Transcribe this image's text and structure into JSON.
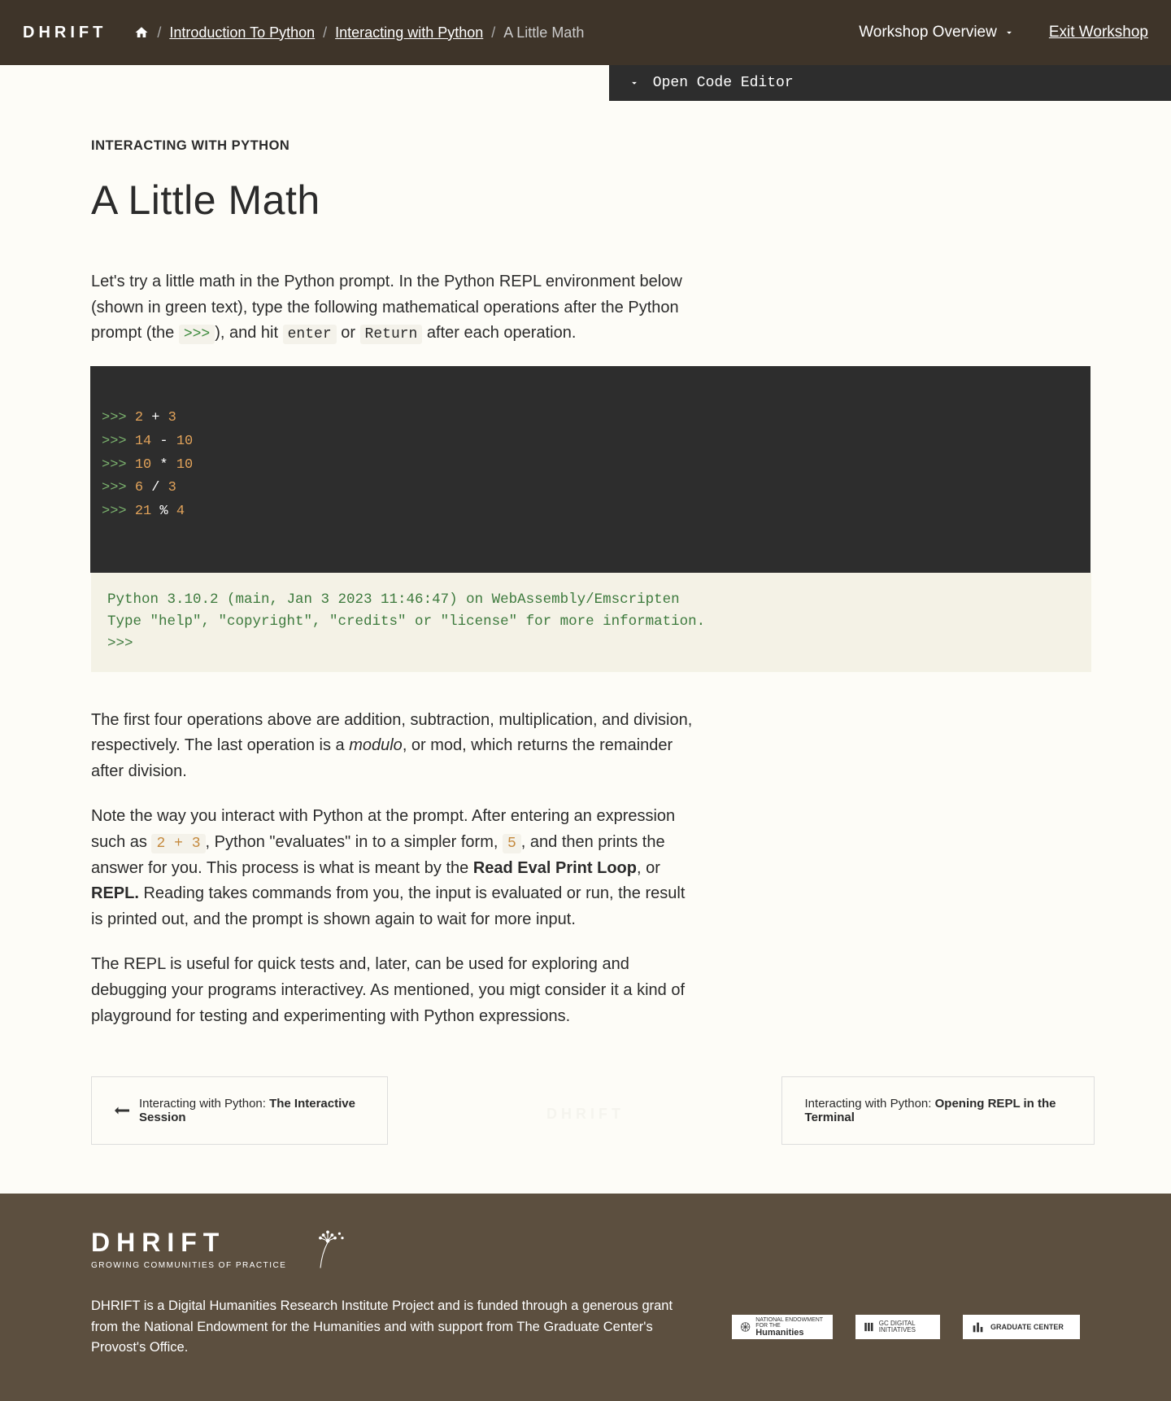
{
  "header": {
    "logo": "DHRIFT",
    "breadcrumbs": {
      "intro": "Introduction To Python",
      "interacting": "Interacting with Python",
      "current": "A Little Math"
    },
    "overview": "Workshop Overview",
    "exit": "Exit Workshop"
  },
  "editor_bar": "Open Code Editor",
  "page": {
    "eyebrow": "INTERACTING WITH PYTHON",
    "title": "A Little Math",
    "intro_1": "Let's try a little math in the Python prompt. In the Python REPL environment below (shown in green text), type the following mathematical operations after the Python prompt (the ",
    "intro_prompt": ">>>",
    "intro_2": "), and hit ",
    "intro_enter": "enter",
    "intro_or": " or ",
    "intro_return": "Return",
    "intro_3": " after each operation.",
    "code_lines": [
      {
        "prompt": ">>>",
        "a": "2",
        "op": "+",
        "b": "3"
      },
      {
        "prompt": ">>>",
        "a": "14",
        "op": "-",
        "b": "10"
      },
      {
        "prompt": ">>>",
        "a": "10",
        "op": "*",
        "b": "10"
      },
      {
        "prompt": ">>>",
        "a": "6",
        "op": "/",
        "b": "3"
      },
      {
        "prompt": ">>>",
        "a": "21",
        "op": "%",
        "b": "4"
      }
    ],
    "terminal_1": "Python 3.10.2 (main, Jan  3 2023 11:46:47) on WebAssembly/Emscripten",
    "terminal_2": "Type \"help\", \"copyright\", \"credits\" or \"license\" for more information.",
    "terminal_3": ">>>",
    "p2_1": "The first four operations above are addition, subtraction, multiplication, and division, respectively. The last operation is a ",
    "p2_em": "modulo",
    "p2_2": ", or mod, which returns the remainder after division.",
    "p3_1": "Note the way you interact with Python at the prompt. After entering an expression such as ",
    "p3_code1": "2 + 3",
    "p3_2": ", Python \"evaluates\" in to a simpler form, ",
    "p3_code2": "5",
    "p3_3": ", and then prints the answer for you. This process is what is meant by the ",
    "p3_strong1": "Read Eval Print Loop",
    "p3_4": ", or ",
    "p3_strong2": "REPL.",
    "p3_5": " Reading takes commands from you, the input is evaluated or run, the result is printed out, and the prompt is shown again to wait for more input.",
    "p4": "The REPL is useful for quick tests and, later, can be used for exploring and debugging your programs interactivey. As mentioned, you migt consider it a kind of playground for testing and experimenting with Python expressions."
  },
  "nav": {
    "prev_prefix": "Interacting with Python: ",
    "prev_title": "The Interactive Session",
    "next_prefix": "Interacting with Python: ",
    "next_title": "Opening REPL in the Terminal",
    "center": "DHRIFT"
  },
  "footer": {
    "logo": "DHRIFT",
    "tagline": "GROWING COMMUNITIES OF PRACTICE",
    "desc": "DHRIFT is a Digital Humanities Research Institute Project and is funded through a generous grant from the National Endowment for the Humanities and with support from The Graduate Center's Provost's Office.",
    "badge1": "Humanities",
    "badge2": "GC DIGITAL INITIATIVES",
    "badge3": "GRADUATE CENTER"
  }
}
